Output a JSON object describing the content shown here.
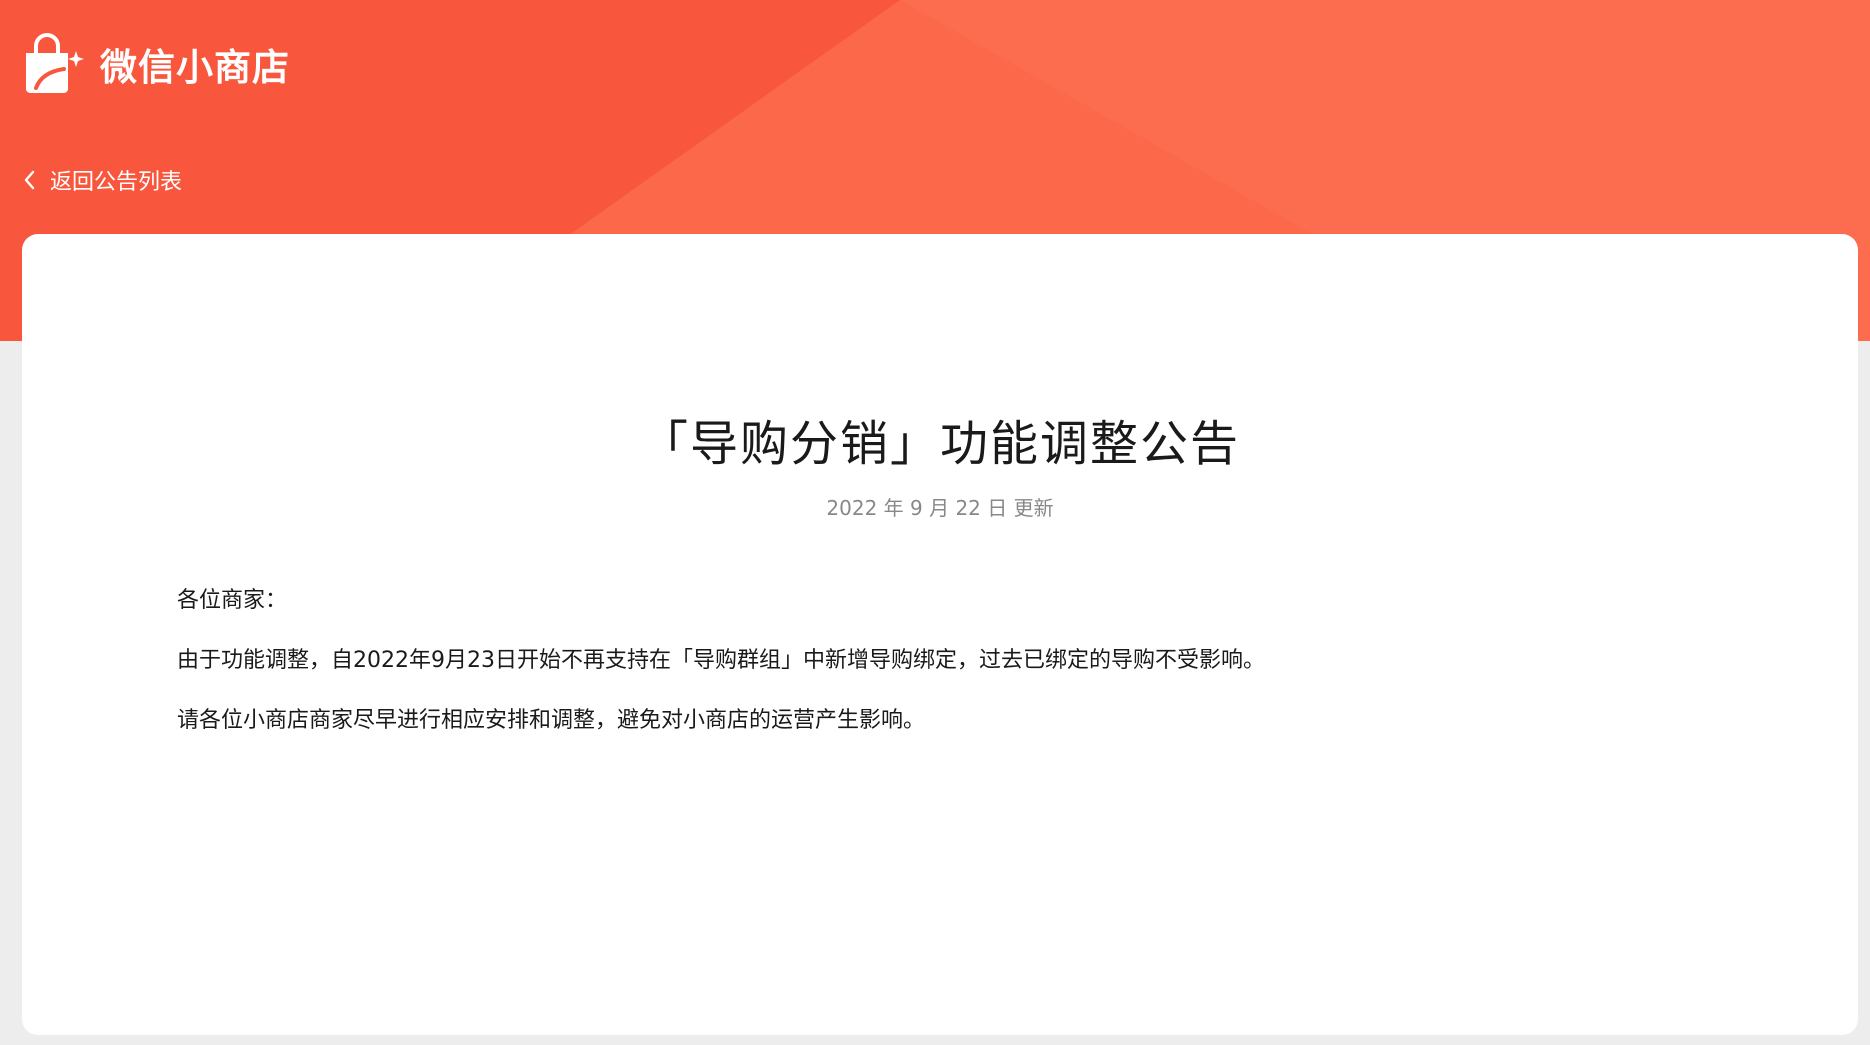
{
  "brand": {
    "name": "微信小商店",
    "icon": "shopping-bag-sparkle-icon",
    "header_color": "#f9573d"
  },
  "nav": {
    "back_label": "返回公告列表",
    "back_icon": "chevron-left-icon"
  },
  "announcement": {
    "title": "「导购分销」功能调整公告",
    "date": "2022 年 9 月 22 日 更新",
    "greeting": "各位商家：",
    "paragraphs": [
      "由于功能调整，自2022年9月23日开始不再支持在「导购群组」中新增导购绑定，过去已绑定的导购不受影响。",
      "请各位小商店商家尽早进行相应安排和调整，避免对小商店的运营产生影响。"
    ]
  }
}
